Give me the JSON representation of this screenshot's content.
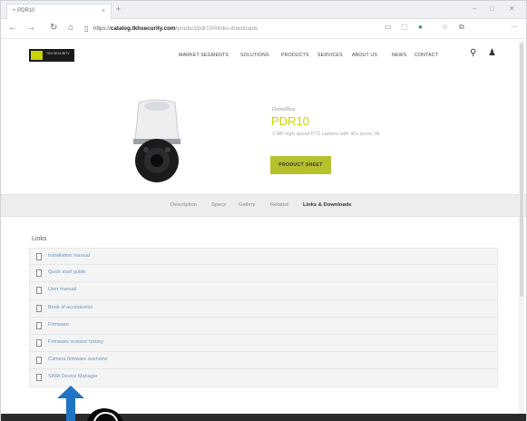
{
  "browser": {
    "tab_title": "+ PDR10",
    "tab_close": "×",
    "new_tab": "+",
    "url_scheme": "https://",
    "url_host": "catalog.tkhsecurity.com",
    "url_path": "/product/pdr10/#links-downloads",
    "win_min": "–",
    "win_max": "□",
    "win_close": "✕"
  },
  "header": {
    "logo_word": "TKH SECURITY",
    "nav": [
      "MARKET SEGMENTS",
      "SOLUTIONS",
      "PRODUCTS",
      "SERVICES",
      "ABOUT US",
      "NEWS",
      "CONTACT"
    ]
  },
  "product": {
    "eyebrow": "Dome/Box",
    "title": "PDR10",
    "description": "2 MP high-speed PTZ camera with 40x zoom, IR",
    "sheet_button": "PRODUCT SHEET"
  },
  "tabs": [
    {
      "label": "Description",
      "active": false
    },
    {
      "label": "Specs",
      "active": false
    },
    {
      "label": "Gallery",
      "active": false
    },
    {
      "label": "Related",
      "active": false
    },
    {
      "label": "Links & Downloads",
      "active": true
    }
  ],
  "links": {
    "heading": "Links",
    "items": [
      "Installation manual",
      "Quick start guide",
      "User manual",
      "Book of accessories",
      "Firmware",
      "Firmware revision history",
      "Camera firmware overview",
      "SIMA Device Manager"
    ]
  },
  "colors": {
    "accent": "#c8d400",
    "button": "#b7c12d",
    "link": "#6d95b9",
    "arrow": "#1f73c4"
  }
}
